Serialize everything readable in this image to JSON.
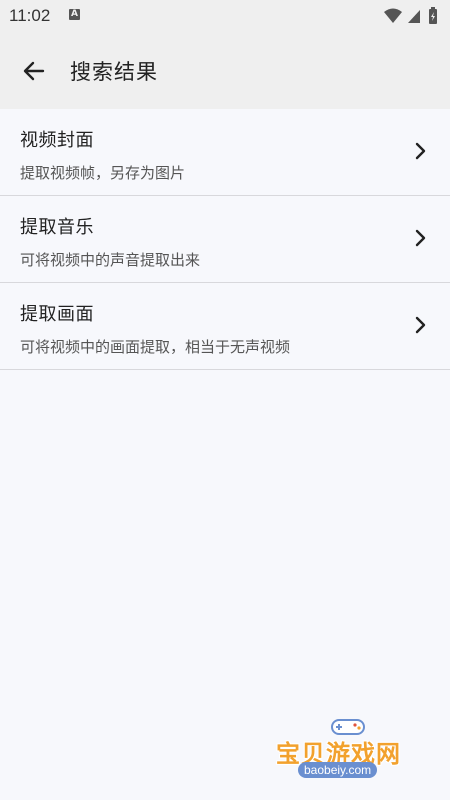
{
  "status_bar": {
    "time": "11:02",
    "notification_icon": "a-icon",
    "icons": [
      "wifi-icon",
      "signal-icon",
      "battery-icon"
    ]
  },
  "app_bar": {
    "back_icon": "arrow-left-icon",
    "title": "搜索结果"
  },
  "results": [
    {
      "title": "视频封面",
      "subtitle": "提取视频帧，另存为图片"
    },
    {
      "title": "提取音乐",
      "subtitle": "可将视频中的声音提取出来"
    },
    {
      "title": "提取画面",
      "subtitle": "可将视频中的画面提取，相当于无声视频"
    }
  ],
  "watermark": {
    "text": "宝贝游戏网",
    "url": "baobeiy.com"
  },
  "colors": {
    "background": "#f7f8fc",
    "app_bar": "#efefef",
    "watermark": "#f2a12d"
  }
}
